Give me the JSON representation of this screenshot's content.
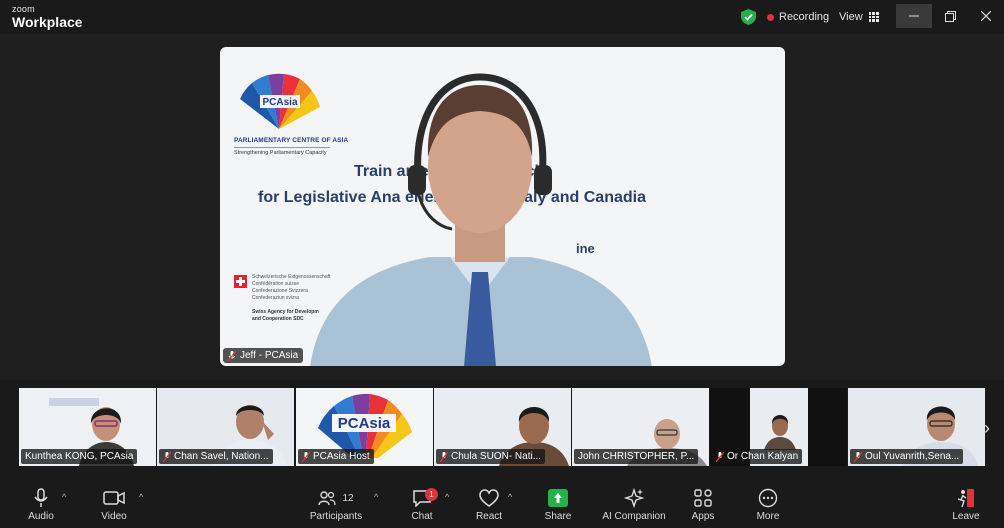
{
  "app": {
    "brand_top": "zoom",
    "brand_bottom": "Workplace"
  },
  "titlebar": {
    "recording_label": "Recording",
    "view_label": "View",
    "colors": {
      "shield": "#26b04a",
      "recording_dot": "#e0323c"
    }
  },
  "speaker": {
    "name": "Jeff - PCAsia",
    "slide": {
      "org_name": "PARLIAMENTARY CENTRE OF ASIA",
      "org_tagline": "Strengthening Parliamentary Capacity",
      "logo_text": "PCAsia",
      "title_line1": "Train    amentary Research",
      "title_line2": "for Legislative Ana        eriences from Italy and Canadia",
      "title_line3": "ine",
      "swiss_lines": [
        "Schweizerische Eidgenossenschaft",
        "Confédération suisse",
        "Confederazione Svizzera",
        "Confederaziun svizra"
      ],
      "swiss_sub": [
        "Swiss Agency for Developm",
        "and Cooperation SDC"
      ]
    }
  },
  "gallery": {
    "tiles": [
      {
        "name": "Kunthea KONG, PCAsia",
        "muted": false
      },
      {
        "name": "Chan Savel, Nation...",
        "muted": true
      },
      {
        "name": "PCAsia Host",
        "muted": true
      },
      {
        "name": "Chula SUON- Nati...",
        "muted": true
      },
      {
        "name": "John CHRISTOPHER, P...",
        "muted": false
      },
      {
        "name": "Or Chan Kalyan",
        "muted": true
      },
      {
        "name": "Oul Yuvanrith,Sena...",
        "muted": true
      }
    ]
  },
  "toolbar": {
    "audio": "Audio",
    "video": "Video",
    "participants": "Participants",
    "participants_count": "12",
    "chat": "Chat",
    "chat_badge": "1",
    "react": "React",
    "share": "Share",
    "ai": "AI Companion",
    "apps": "Apps",
    "more": "More",
    "leave": "Leave",
    "colors": {
      "share": "#26b04a",
      "leave": "#e0323c"
    }
  }
}
